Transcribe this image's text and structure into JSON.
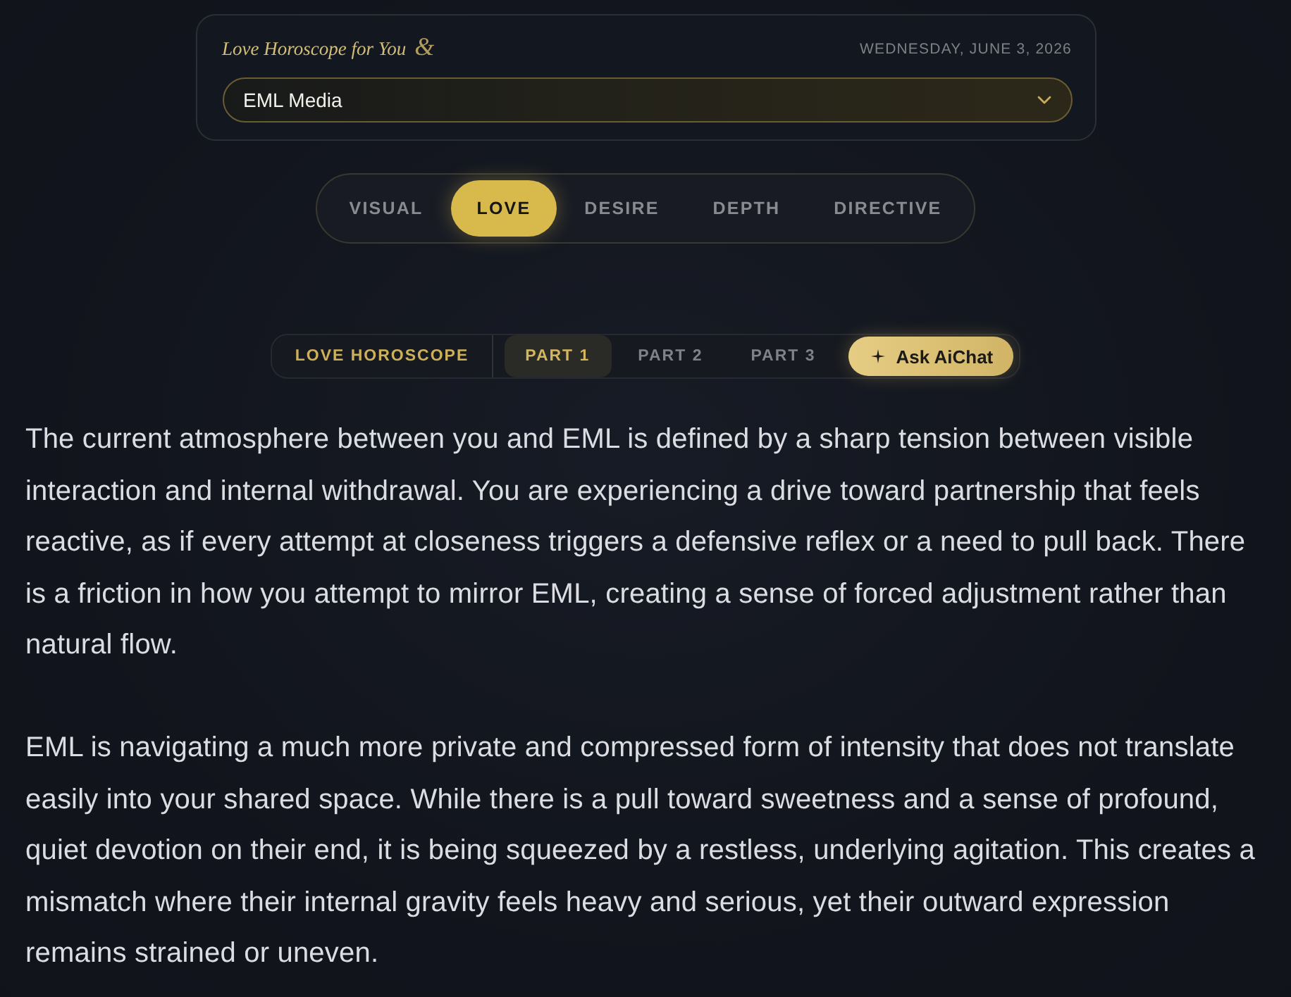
{
  "header": {
    "title": "Love Horoscope for You",
    "ornament": "&",
    "date": "WEDNESDAY, JUNE 3, 2026",
    "select": {
      "value": "EML Media"
    }
  },
  "tabs": [
    {
      "label": "VISUAL",
      "selected": false
    },
    {
      "label": "LOVE",
      "selected": true
    },
    {
      "label": "DESIRE",
      "selected": false
    },
    {
      "label": "DEPTH",
      "selected": false
    },
    {
      "label": "DIRECTIVE",
      "selected": false
    }
  ],
  "subnav": {
    "label": "LOVE HOROSCOPE",
    "parts": [
      {
        "label": "PART 1",
        "selected": true
      },
      {
        "label": "PART 2",
        "selected": false
      },
      {
        "label": "PART 3",
        "selected": false
      }
    ],
    "action": {
      "label": "Ask AiChat"
    }
  },
  "paragraphs": [
    "The current atmosphere between you and EML is defined by a sharp tension between visible interaction and internal withdrawal. You are experiencing a drive toward partnership that feels reactive, as if every attempt at closeness triggers a defensive reflex or a need to pull back. There is a friction in how you attempt to mirror EML, creating a sense of forced adjustment rather than natural flow.",
    "EML is navigating a much more private and compressed form of intensity that does not translate easily into your shared space. While there is a pull toward sweetness and a sense of profound, quiet devotion on their end, it is being squeezed by a restless, underlying agitation. This creates a mismatch where their internal gravity feels heavy and serious, yet their outward expression remains strained or uneven."
  ]
}
